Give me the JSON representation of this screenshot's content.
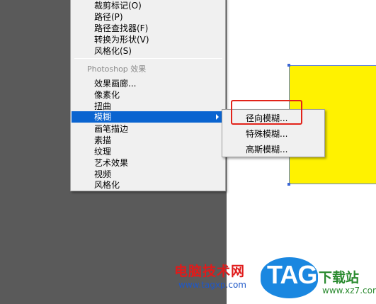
{
  "menu": {
    "items_top": [
      {
        "label": "裁剪标记(O)"
      },
      {
        "label": "路径(P)"
      },
      {
        "label": "路径查找器(F)"
      },
      {
        "label": "转换为形状(V)"
      },
      {
        "label": "风格化(S)"
      }
    ],
    "section_header": "Photoshop 效果",
    "items_photoshop": [
      {
        "label": "效果画廊..."
      },
      {
        "label": "像素化"
      },
      {
        "label": "扭曲"
      },
      {
        "label": "模糊"
      },
      {
        "label": "画笔描边"
      },
      {
        "label": "素描"
      },
      {
        "label": "纹理"
      },
      {
        "label": "艺术效果"
      },
      {
        "label": "视频"
      },
      {
        "label": "风格化"
      }
    ]
  },
  "submenu": {
    "items": [
      {
        "label": "径向模糊..."
      },
      {
        "label": "特殊模糊..."
      },
      {
        "label": "高斯模糊..."
      }
    ]
  },
  "colors": {
    "highlight": "#0a64d0",
    "shape_fill": "#fff200",
    "annotation": "#e2231a"
  },
  "watermark": {
    "site_name": "电脑技术网",
    "site_url": "www.tagxp.com",
    "logo_text": "TAG",
    "site_name_2": "下载站",
    "site_url_2": "www.xz7.com"
  }
}
